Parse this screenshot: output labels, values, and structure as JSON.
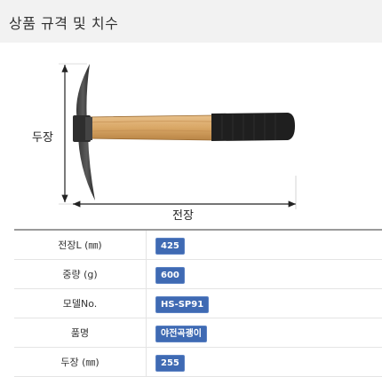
{
  "section": {
    "title": "상품 규격 및 치수"
  },
  "figure": {
    "height_label": "두장",
    "length_label": "전장",
    "icons": [
      "pickaxe-illustration",
      "dimension-arrow-vertical",
      "dimension-arrow-horizontal"
    ]
  },
  "specs": [
    {
      "label": "전장L (㎜)",
      "value": "425"
    },
    {
      "label": "중량 (g)",
      "value": "600"
    },
    {
      "label": "모델No.",
      "value": "HS-SP91"
    },
    {
      "label": "품명",
      "value": "야전곡괭이"
    },
    {
      "label": "두장 (㎜)",
      "value": "255"
    }
  ],
  "colors": {
    "header_bg": "#f2f2f2",
    "badge": "#3f6ab3",
    "handle_wood": "#d9a766",
    "grip": "#222222"
  }
}
